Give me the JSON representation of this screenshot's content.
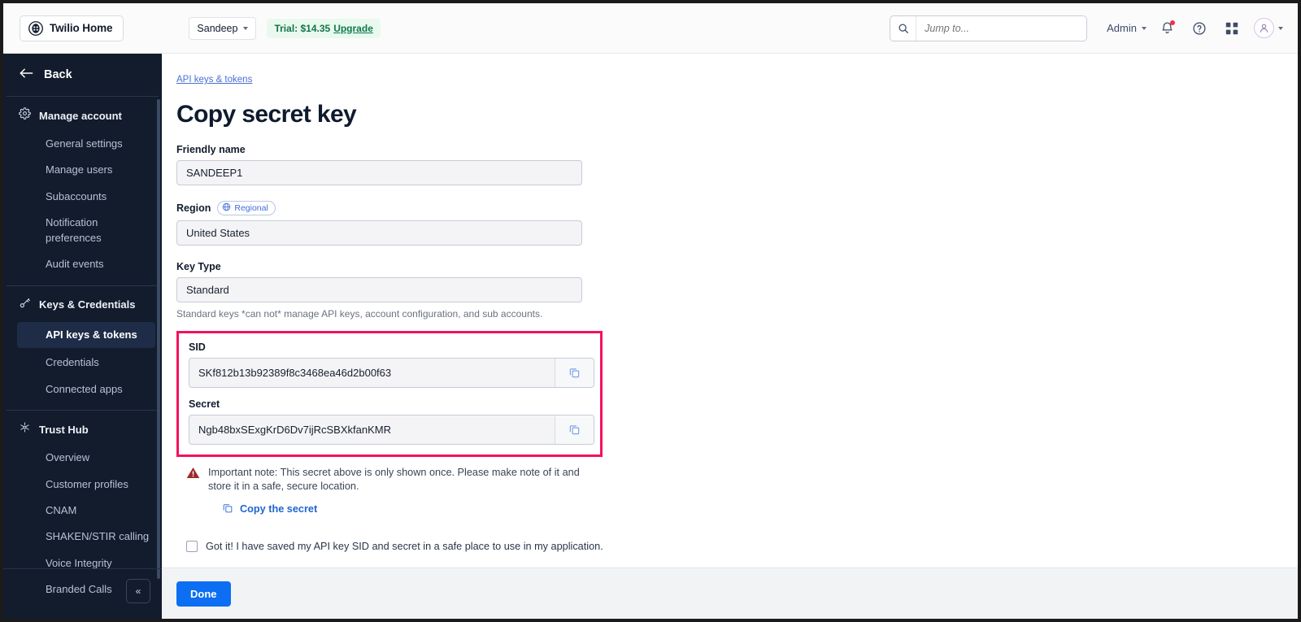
{
  "topbar": {
    "home_label": "Twilio Home",
    "account_label": "Sandeep",
    "trial_prefix": "Trial: $14.35",
    "trial_upgrade": "Upgrade",
    "search_placeholder": "Jump to...",
    "admin_label": "Admin"
  },
  "sidebar": {
    "back_label": "Back",
    "groups": [
      {
        "title": "Manage account",
        "icon": "gear-icon",
        "items": [
          {
            "label": "General settings",
            "active": false
          },
          {
            "label": "Manage users",
            "active": false
          },
          {
            "label": "Subaccounts",
            "active": false
          },
          {
            "label": "Notification preferences",
            "active": false
          },
          {
            "label": "Audit events",
            "active": false
          }
        ]
      },
      {
        "title": "Keys & Credentials",
        "icon": "key-icon",
        "items": [
          {
            "label": "API keys & tokens",
            "active": true
          },
          {
            "label": "Credentials",
            "active": false
          },
          {
            "label": "Connected apps",
            "active": false
          }
        ]
      },
      {
        "title": "Trust Hub",
        "icon": "trusthub-icon",
        "items": [
          {
            "label": "Overview",
            "active": false
          },
          {
            "label": "Customer profiles",
            "active": false
          },
          {
            "label": "CNAM",
            "active": false
          },
          {
            "label": "SHAKEN/STIR calling",
            "active": false
          },
          {
            "label": "Voice Integrity",
            "active": false
          },
          {
            "label": "Branded Calls",
            "active": false
          }
        ]
      }
    ],
    "collapse_label": "«"
  },
  "main": {
    "breadcrumb": "API keys & tokens",
    "page_title": "Copy secret key",
    "friendly_name_label": "Friendly name",
    "friendly_name_value": "SANDEEP1",
    "region_label": "Region",
    "region_badge": "Regional",
    "region_value": "United States",
    "key_type_label": "Key Type",
    "key_type_value": "Standard",
    "key_type_helper": "Standard keys *can not* manage API keys, account configuration, and sub accounts.",
    "sid_label": "SID",
    "sid_value": "SKf812b13b92389f8c3468ea46d2b00f63",
    "secret_label": "Secret",
    "secret_value": "Ngb48bxSExgKrD6Dv7ijRcSBXkfanKMR",
    "note_text": "Important note: This secret above is only shown once. Please make note of it and store it in a safe, secure location.",
    "copy_secret_link": "Copy the secret",
    "checkbox_label": "Got it! I have saved my API key SID and secret in a safe place to use in my application.",
    "done_label": "Done"
  },
  "colors": {
    "highlight": "#f5115e",
    "primary_button": "#0c6ef2",
    "sidebar_bg": "#121c2d",
    "link": "#2065d1",
    "trial_bg": "#e9f9ee",
    "trial_text": "#14734c"
  }
}
